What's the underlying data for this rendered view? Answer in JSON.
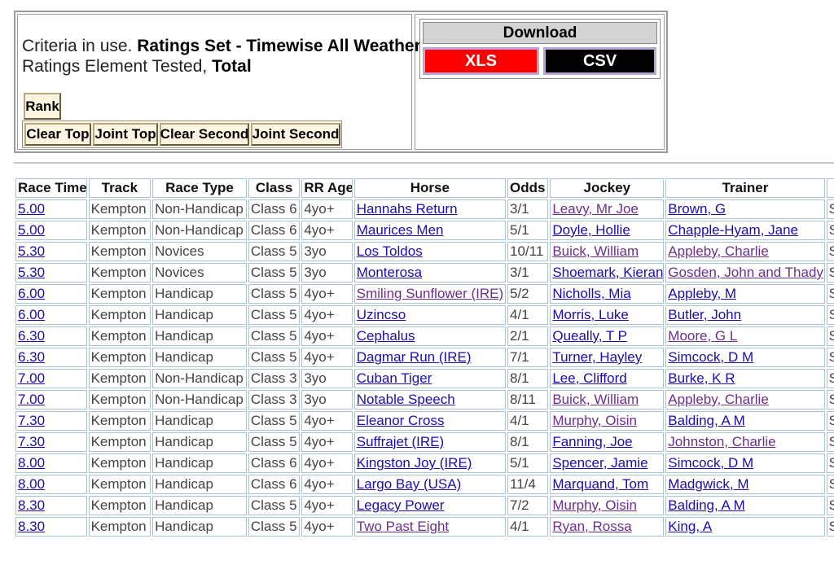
{
  "criteria": {
    "line1_prefix": "Criteria in use. ",
    "line1_bold": "Ratings Set - Timewise All Weather",
    "line2_prefix": "Ratings Element Tested, ",
    "line2_bold": "Total"
  },
  "rank_buttons": {
    "rank": "Rank",
    "clear_top": "Clear Top",
    "joint_top": "Joint Top",
    "clear_second": "Clear Second",
    "joint_second": "Joint Second"
  },
  "download": {
    "title": "Download",
    "xls": "XLS",
    "csv": "CSV",
    "xls_color": "#ff0000",
    "csv_color": "#000000"
  },
  "table": {
    "headers": [
      "Race Time",
      "Track",
      "Race Type",
      "Class",
      "RR Age",
      "Horse",
      "Odds",
      "Jockey",
      "Trainer",
      ""
    ],
    "rows": [
      {
        "time": "5.00",
        "track": "Kempton",
        "type": "Non-Handicap",
        "cls": "Class 6",
        "age": "4yo+",
        "horse": "Hannahs Return",
        "horse_visited": false,
        "odds": "3/1",
        "jockey": "Leavy, Mr Joe",
        "jockey_visited": true,
        "trainer": "Brown, G",
        "trainer_visited": false,
        "extra": "S"
      },
      {
        "time": "5.00",
        "track": "Kempton",
        "type": "Non-Handicap",
        "cls": "Class 6",
        "age": "4yo+",
        "horse": "Maurices Men",
        "horse_visited": false,
        "odds": "5/1",
        "jockey": "Doyle, Hollie",
        "jockey_visited": false,
        "trainer": "Chapple-Hyam, Jane",
        "trainer_visited": false,
        "extra": "S"
      },
      {
        "time": "5.30",
        "track": "Kempton",
        "type": "Novices",
        "cls": "Class 5",
        "age": "3yo",
        "horse": "Los Toldos",
        "horse_visited": false,
        "odds": "10/11",
        "jockey": "Buick, William",
        "jockey_visited": true,
        "trainer": "Appleby, Charlie",
        "trainer_visited": true,
        "extra": "S"
      },
      {
        "time": "5.30",
        "track": "Kempton",
        "type": "Novices",
        "cls": "Class 5",
        "age": "3yo",
        "horse": "Monterosa",
        "horse_visited": false,
        "odds": "3/1",
        "jockey": "Shoemark, Kieran",
        "jockey_visited": false,
        "trainer": "Gosden, John and Thady",
        "trainer_visited": true,
        "extra": "S"
      },
      {
        "time": "6.00",
        "track": "Kempton",
        "type": "Handicap",
        "cls": "Class 5",
        "age": "4yo+",
        "horse": "Smiling Sunflower (IRE)",
        "horse_visited": true,
        "odds": "5/2",
        "jockey": "Nicholls, Mia",
        "jockey_visited": false,
        "trainer": "Appleby, M",
        "trainer_visited": false,
        "extra": "S"
      },
      {
        "time": "6.00",
        "track": "Kempton",
        "type": "Handicap",
        "cls": "Class 5",
        "age": "4yo+",
        "horse": "Uzincso",
        "horse_visited": false,
        "odds": "4/1",
        "jockey": "Morris, Luke",
        "jockey_visited": false,
        "trainer": "Butler, John",
        "trainer_visited": false,
        "extra": "S"
      },
      {
        "time": "6.30",
        "track": "Kempton",
        "type": "Handicap",
        "cls": "Class 5",
        "age": "4yo+",
        "horse": "Cephalus",
        "horse_visited": false,
        "odds": "2/1",
        "jockey": "Queally, T P",
        "jockey_visited": false,
        "trainer": "Moore, G L",
        "trainer_visited": true,
        "extra": "S"
      },
      {
        "time": "6.30",
        "track": "Kempton",
        "type": "Handicap",
        "cls": "Class 5",
        "age": "4yo+",
        "horse": "Dagmar Run (IRE)",
        "horse_visited": false,
        "odds": "7/1",
        "jockey": "Turner, Hayley",
        "jockey_visited": false,
        "trainer": "Simcock, D M",
        "trainer_visited": false,
        "extra": "S"
      },
      {
        "time": "7.00",
        "track": "Kempton",
        "type": "Non-Handicap",
        "cls": "Class 3",
        "age": "3yo",
        "horse": "Cuban Tiger",
        "horse_visited": false,
        "odds": "8/1",
        "jockey": "Lee, Clifford",
        "jockey_visited": false,
        "trainer": "Burke, K R",
        "trainer_visited": false,
        "extra": "S"
      },
      {
        "time": "7.00",
        "track": "Kempton",
        "type": "Non-Handicap",
        "cls": "Class 3",
        "age": "3yo",
        "horse": "Notable Speech",
        "horse_visited": false,
        "odds": "8/11",
        "jockey": "Buick, William",
        "jockey_visited": true,
        "trainer": "Appleby, Charlie",
        "trainer_visited": true,
        "extra": "S"
      },
      {
        "time": "7.30",
        "track": "Kempton",
        "type": "Handicap",
        "cls": "Class 5",
        "age": "4yo+",
        "horse": "Eleanor Cross",
        "horse_visited": false,
        "odds": "4/1",
        "jockey": "Murphy, Oisin",
        "jockey_visited": true,
        "trainer": "Balding, A M",
        "trainer_visited": false,
        "extra": "S"
      },
      {
        "time": "7.30",
        "track": "Kempton",
        "type": "Handicap",
        "cls": "Class 5",
        "age": "4yo+",
        "horse": "Suffrajet (IRE)",
        "horse_visited": false,
        "odds": "8/1",
        "jockey": "Fanning, Joe",
        "jockey_visited": false,
        "trainer": "Johnston, Charlie",
        "trainer_visited": true,
        "extra": "S"
      },
      {
        "time": "8.00",
        "track": "Kempton",
        "type": "Handicap",
        "cls": "Class 6",
        "age": "4yo+",
        "horse": "Kingston Joy (IRE)",
        "horse_visited": false,
        "odds": "5/1",
        "jockey": "Spencer, Jamie",
        "jockey_visited": false,
        "trainer": "Simcock, D M",
        "trainer_visited": false,
        "extra": "S"
      },
      {
        "time": "8.00",
        "track": "Kempton",
        "type": "Handicap",
        "cls": "Class 6",
        "age": "4yo+",
        "horse": "Largo Bay (USA)",
        "horse_visited": false,
        "odds": "11/4",
        "jockey": "Marquand, Tom",
        "jockey_visited": false,
        "trainer": "Madgwick, M",
        "trainer_visited": false,
        "extra": "S"
      },
      {
        "time": "8.30",
        "track": "Kempton",
        "type": "Handicap",
        "cls": "Class 5",
        "age": "4yo+",
        "horse": "Legacy Power",
        "horse_visited": false,
        "odds": "7/2",
        "jockey": "Murphy, Oisin",
        "jockey_visited": true,
        "trainer": "Balding, A M",
        "trainer_visited": false,
        "extra": "S"
      },
      {
        "time": "8.30",
        "track": "Kempton",
        "type": "Handicap",
        "cls": "Class 5",
        "age": "4yo+",
        "horse": "Two Past Eight",
        "horse_visited": true,
        "odds": "4/1",
        "jockey": "Ryan, Rossa",
        "jockey_visited": true,
        "trainer": "King, A",
        "trainer_visited": false,
        "extra": "S"
      }
    ]
  }
}
